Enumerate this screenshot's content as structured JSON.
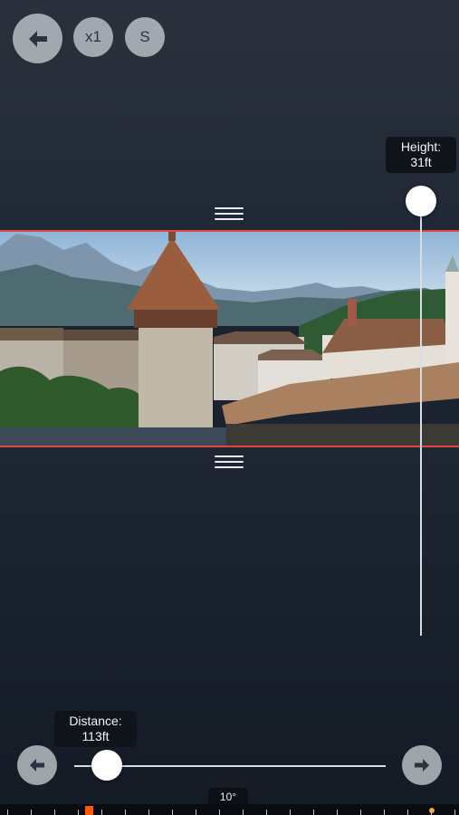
{
  "toolbar": {
    "back_icon": "arrow-left-icon",
    "zoom_label": "x1",
    "mode_label": "S"
  },
  "height_slider": {
    "label": "Height:",
    "value": "31ft"
  },
  "distance_slider": {
    "label": "Distance:",
    "value": "113ft",
    "decrease_icon": "arrow-left-icon",
    "increase_icon": "arrow-right-icon"
  },
  "angle": {
    "value": "10°"
  },
  "colors": {
    "selection_line": "#e0463c",
    "ruler_marker": "#ff5a00",
    "ruler_dot": "#ff9f1a"
  }
}
